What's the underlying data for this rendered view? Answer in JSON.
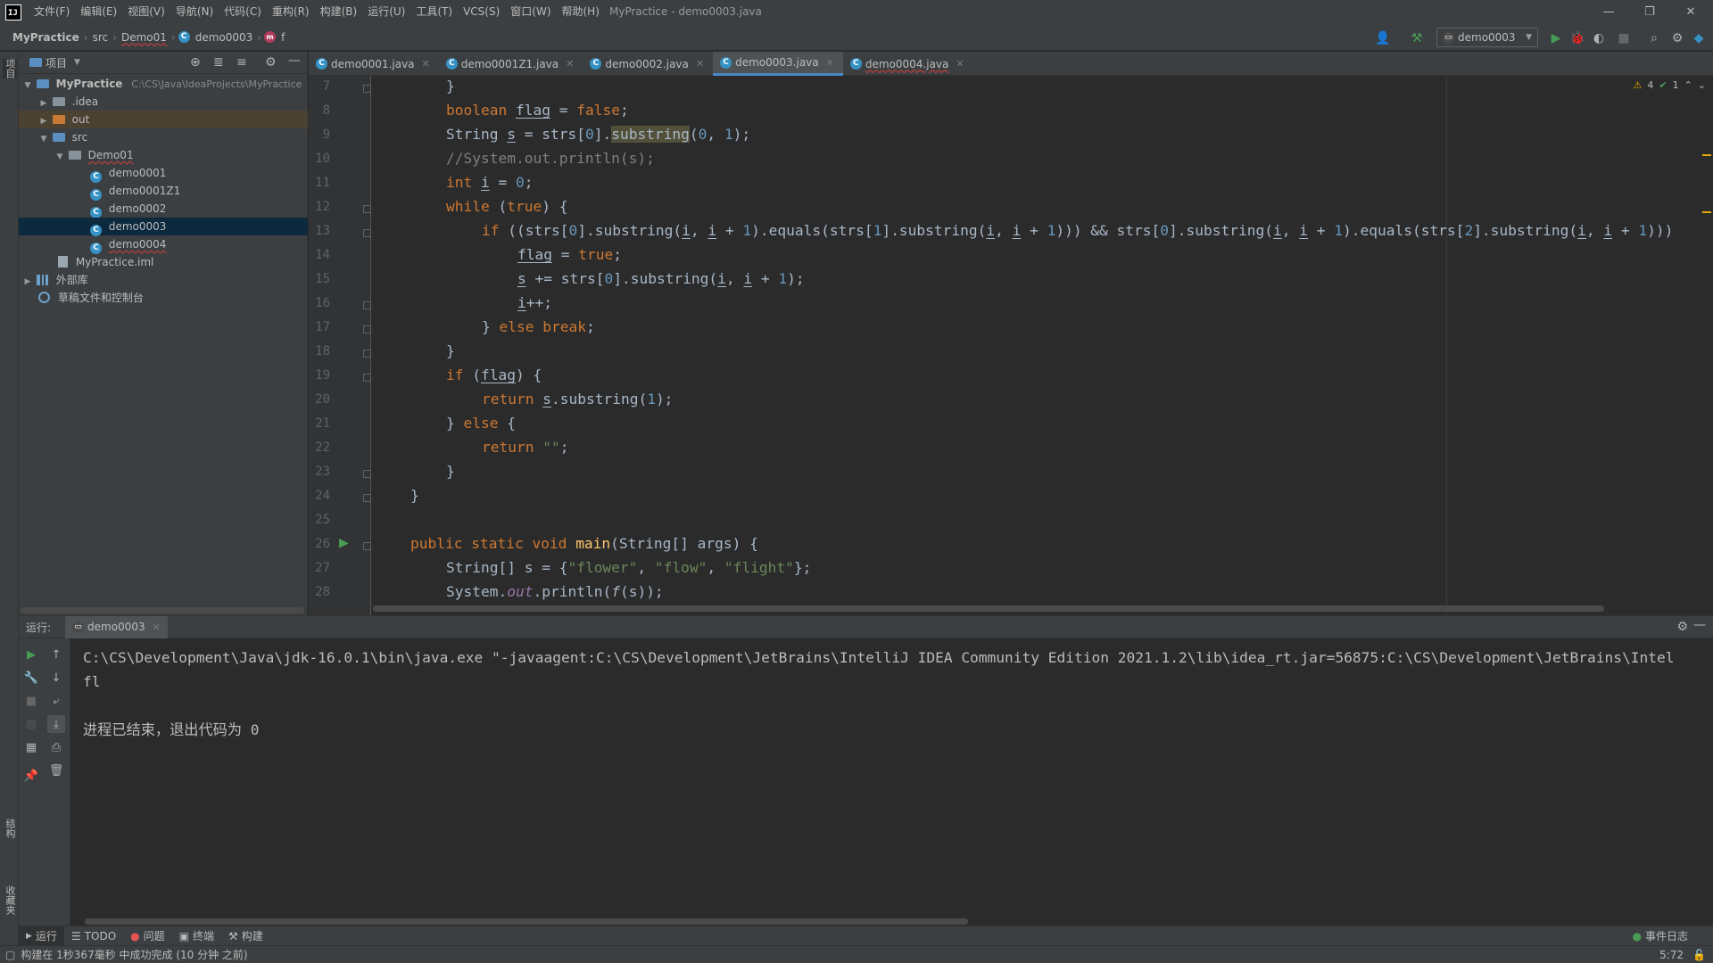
{
  "menubar": {
    "items": [
      "文件(F)",
      "编辑(E)",
      "视图(V)",
      "导航(N)",
      "代码(C)",
      "重构(R)",
      "构建(B)",
      "运行(U)",
      "工具(T)",
      "VCS(S)",
      "窗口(W)",
      "帮助(H)"
    ],
    "window_title": "MyPractice - demo0003.java"
  },
  "navbar": {
    "project": "MyPractice",
    "src": "src",
    "package": "Demo01",
    "class": "demo0003",
    "method": "f",
    "run_config": "demo0003"
  },
  "project_panel": {
    "title": "项目",
    "root": "MyPractice",
    "root_path": "C:\\CS\\Java\\IdeaProjects\\MyPractice",
    "idea": ".idea",
    "out": "out",
    "src": "src",
    "package": "Demo01",
    "files": [
      "demo0001",
      "demo0001Z1",
      "demo0002",
      "demo0003",
      "demo0004"
    ],
    "iml": "MyPractice.iml",
    "external_libs": "外部库",
    "scratches": "草稿文件和控制台"
  },
  "editor": {
    "tabs": [
      {
        "label": "demo0001.java",
        "active": false
      },
      {
        "label": "demo0001Z1.java",
        "active": false
      },
      {
        "label": "demo0002.java",
        "active": false
      },
      {
        "label": "demo0003.java",
        "active": true
      },
      {
        "label": "demo0004.java",
        "active": false
      }
    ],
    "line_numbers": [
      "7",
      "8",
      "9",
      "10",
      "11",
      "12",
      "13",
      "14",
      "15",
      "16",
      "17",
      "18",
      "19",
      "20",
      "21",
      "22",
      "23",
      "24",
      "25",
      "26",
      "27",
      "28"
    ],
    "warnings": "4",
    "ok": "1"
  },
  "run_panel": {
    "label": "运行:",
    "tab": "demo0003",
    "console": {
      "cmd": "C:\\CS\\Development\\Java\\jdk-16.0.1\\bin\\java.exe \"-javaagent:C:\\CS\\Development\\JetBrains\\IntelliJ IDEA Community Edition 2021.1.2\\lib\\idea_rt.jar=56875:C:\\CS\\Development\\JetBrains\\Intel",
      "output": "fl",
      "exit": "进程已结束，退出代码为 0"
    }
  },
  "tool_tabs": {
    "run": "运行",
    "todo": "TODO",
    "problems": "问题",
    "terminal": "终端",
    "build": "构建",
    "event_log": "事件日志"
  },
  "status": {
    "message": "构建在 1秒367毫秒 中成功完成 (10 分钟 之前)",
    "position": "5:72"
  },
  "side_labels": {
    "project": "项目",
    "structure": "结构",
    "favorites": "收藏夹"
  },
  "colors": {
    "background": "#2b2b2b",
    "panel": "#3c3f41",
    "keyword": "#cc7832",
    "number": "#6897bb",
    "string": "#6a8759",
    "comment": "#808080",
    "function": "#ffc66d",
    "selection": "#0d293e"
  }
}
